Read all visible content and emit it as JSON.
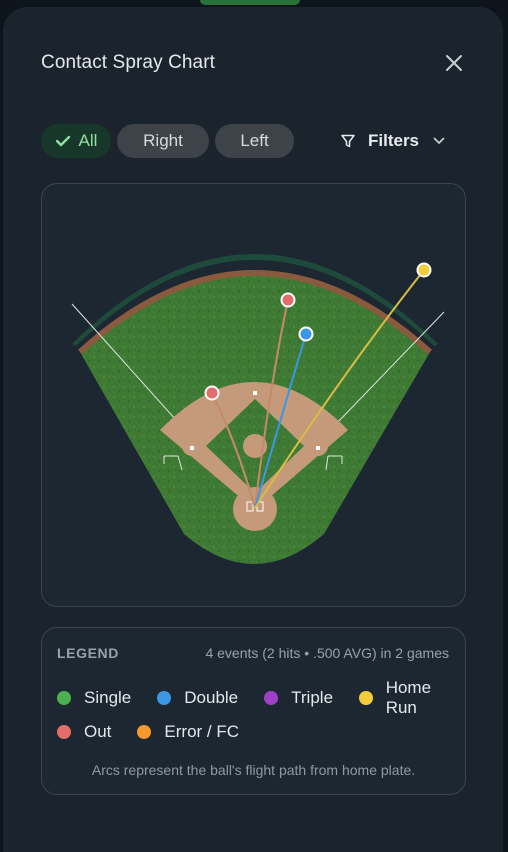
{
  "header": {
    "title": "Contact Spray Chart",
    "close_icon": "close-icon"
  },
  "segments": [
    {
      "label": "All",
      "selected": true,
      "icon": "check-icon"
    },
    {
      "label": "Right",
      "selected": false
    },
    {
      "label": "Left",
      "selected": false
    }
  ],
  "filters": {
    "label": "Filters",
    "icon": "filter-icon",
    "chevron": "chevron-down-icon"
  },
  "spray": {
    "hits": [
      {
        "result": "Out",
        "color": "#e36d6d"
      },
      {
        "result": "Out",
        "color": "#e36d6d"
      },
      {
        "result": "Double",
        "color": "#3a97e6"
      },
      {
        "result": "Home Run",
        "color": "#f2cd3b"
      }
    ]
  },
  "legend": {
    "title": "LEGEND",
    "summary": "4 events (2 hits • .500 AVG) in 2 games",
    "items": [
      {
        "label": "Single",
        "color": "#4caf50"
      },
      {
        "label": "Double",
        "color": "#3a97e6"
      },
      {
        "label": "Triple",
        "color": "#a040c8"
      },
      {
        "label": "Home Run",
        "color": "#f2cd3b"
      },
      {
        "label": "Out",
        "color": "#e36d6d"
      },
      {
        "label": "Error / FC",
        "color": "#f59a2c"
      }
    ],
    "note": "Arcs represent the ball's flight path from home plate."
  }
}
